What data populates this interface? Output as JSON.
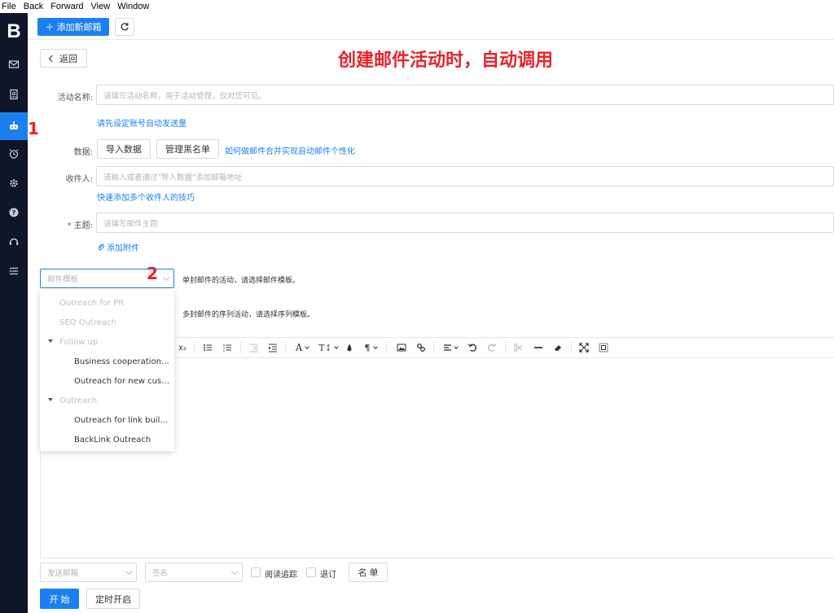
{
  "menubar": {
    "items": [
      "File",
      "Back",
      "Forward",
      "View",
      "Window"
    ]
  },
  "sidebar": {
    "logo": "B",
    "items": [
      {
        "icon": "mail-icon"
      },
      {
        "icon": "contacts-icon"
      },
      {
        "icon": "robot-icon",
        "active": true
      },
      {
        "icon": "alarm-icon"
      },
      {
        "icon": "gear-icon"
      },
      {
        "icon": "help-icon"
      },
      {
        "icon": "support-icon"
      },
      {
        "icon": "list-icon"
      }
    ]
  },
  "topbar": {
    "add_mailbox_label": "＋ 添加新邮箱",
    "refresh_icon": "refresh-icon"
  },
  "back_label": "返回",
  "annotations": {
    "title": "创建邮件活动时，自动调用",
    "marker_1": "1",
    "marker_2": "2"
  },
  "form": {
    "name_label": "活动名称:",
    "name_placeholder": "请填写活动名称，用于活动管理，仅对您可见。",
    "set_quota_link": "请先设定账号自动发送量",
    "data_label": "数据:",
    "import_button": "导入数据",
    "blacklist_button": "管理黑名单",
    "merge_link": "如何做邮件合并实现自动邮件个性化",
    "recipient_label": "收件人:",
    "recipient_placeholder": "请输入或者通过\"导入数据\"添加邮箱地址",
    "quick_add_link": "快速添加多个收件人的技巧",
    "subject_required": "*",
    "subject_label": "主题:",
    "subject_placeholder": "请填写邮件主题",
    "attachment_link": "添加附件"
  },
  "template": {
    "placeholder": "邮件模板",
    "hint_single": "单封邮件的活动，请选择邮件模板。",
    "hint_sequence": "多封邮件的序列活动，请选择序列模板。",
    "options": [
      {
        "label": "Outreach for PR",
        "kind": "disabled"
      },
      {
        "label": "SEO Outreach",
        "kind": "disabled"
      },
      {
        "label": "Follow up",
        "kind": "group"
      },
      {
        "label": "Business cooperation d...",
        "kind": "child"
      },
      {
        "label": "Outreach for new custo...",
        "kind": "child"
      },
      {
        "label": "Outreach",
        "kind": "group"
      },
      {
        "label": "Outreach for link buildi...",
        "kind": "child"
      },
      {
        "label": "BackLink Outreach",
        "kind": "child"
      }
    ]
  },
  "toolbar": {
    "subscript": "x₂",
    "font_size": "T↕",
    "paragraph": "¶",
    "font": "A"
  },
  "bottom": {
    "sender_placeholder": "发送邮箱",
    "signature_placeholder": "签名",
    "read_tracking_label": "阅读追踪",
    "unsubscribe_label": "退订",
    "list_button": "名 单",
    "start_button": "开 始",
    "schedule_button": "定时开启"
  },
  "colors": {
    "primary": "#1c7ff0",
    "sidebar": "#0e1627",
    "annotation": "#e8232a"
  }
}
